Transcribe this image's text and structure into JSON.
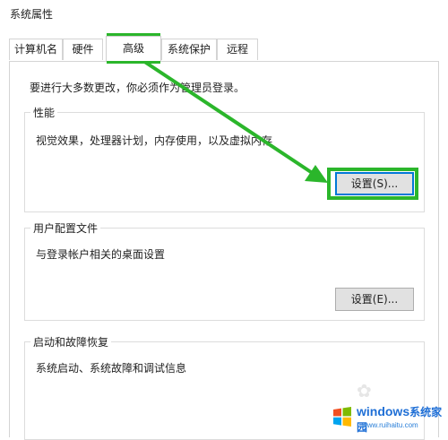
{
  "window": {
    "title": "系统属性"
  },
  "tabs": [
    {
      "label": "计算机名"
    },
    {
      "label": "硬件"
    },
    {
      "label": "高级"
    },
    {
      "label": "系统保护"
    },
    {
      "label": "远程"
    }
  ],
  "active_tab": "高级",
  "admin_note": "要进行大多数更改，你必须作为管理员登录。",
  "groups": {
    "performance": {
      "title": "性能",
      "description": "视觉效果，处理器计划，内存使用，以及虚拟内存",
      "button": "设置(S)..."
    },
    "user_profiles": {
      "title": "用户配置文件",
      "description": "与登录帐户相关的桌面设置",
      "button": "设置(E)..."
    },
    "startup_recovery": {
      "title": "启动和故障恢复",
      "description": "系统启动、系统故障和调试信息"
    }
  },
  "annotation": {
    "color": "#2bb62b"
  },
  "watermark": {
    "brand": "windows",
    "suffix": "系统家园",
    "url": "www.ruihaitu.com"
  }
}
